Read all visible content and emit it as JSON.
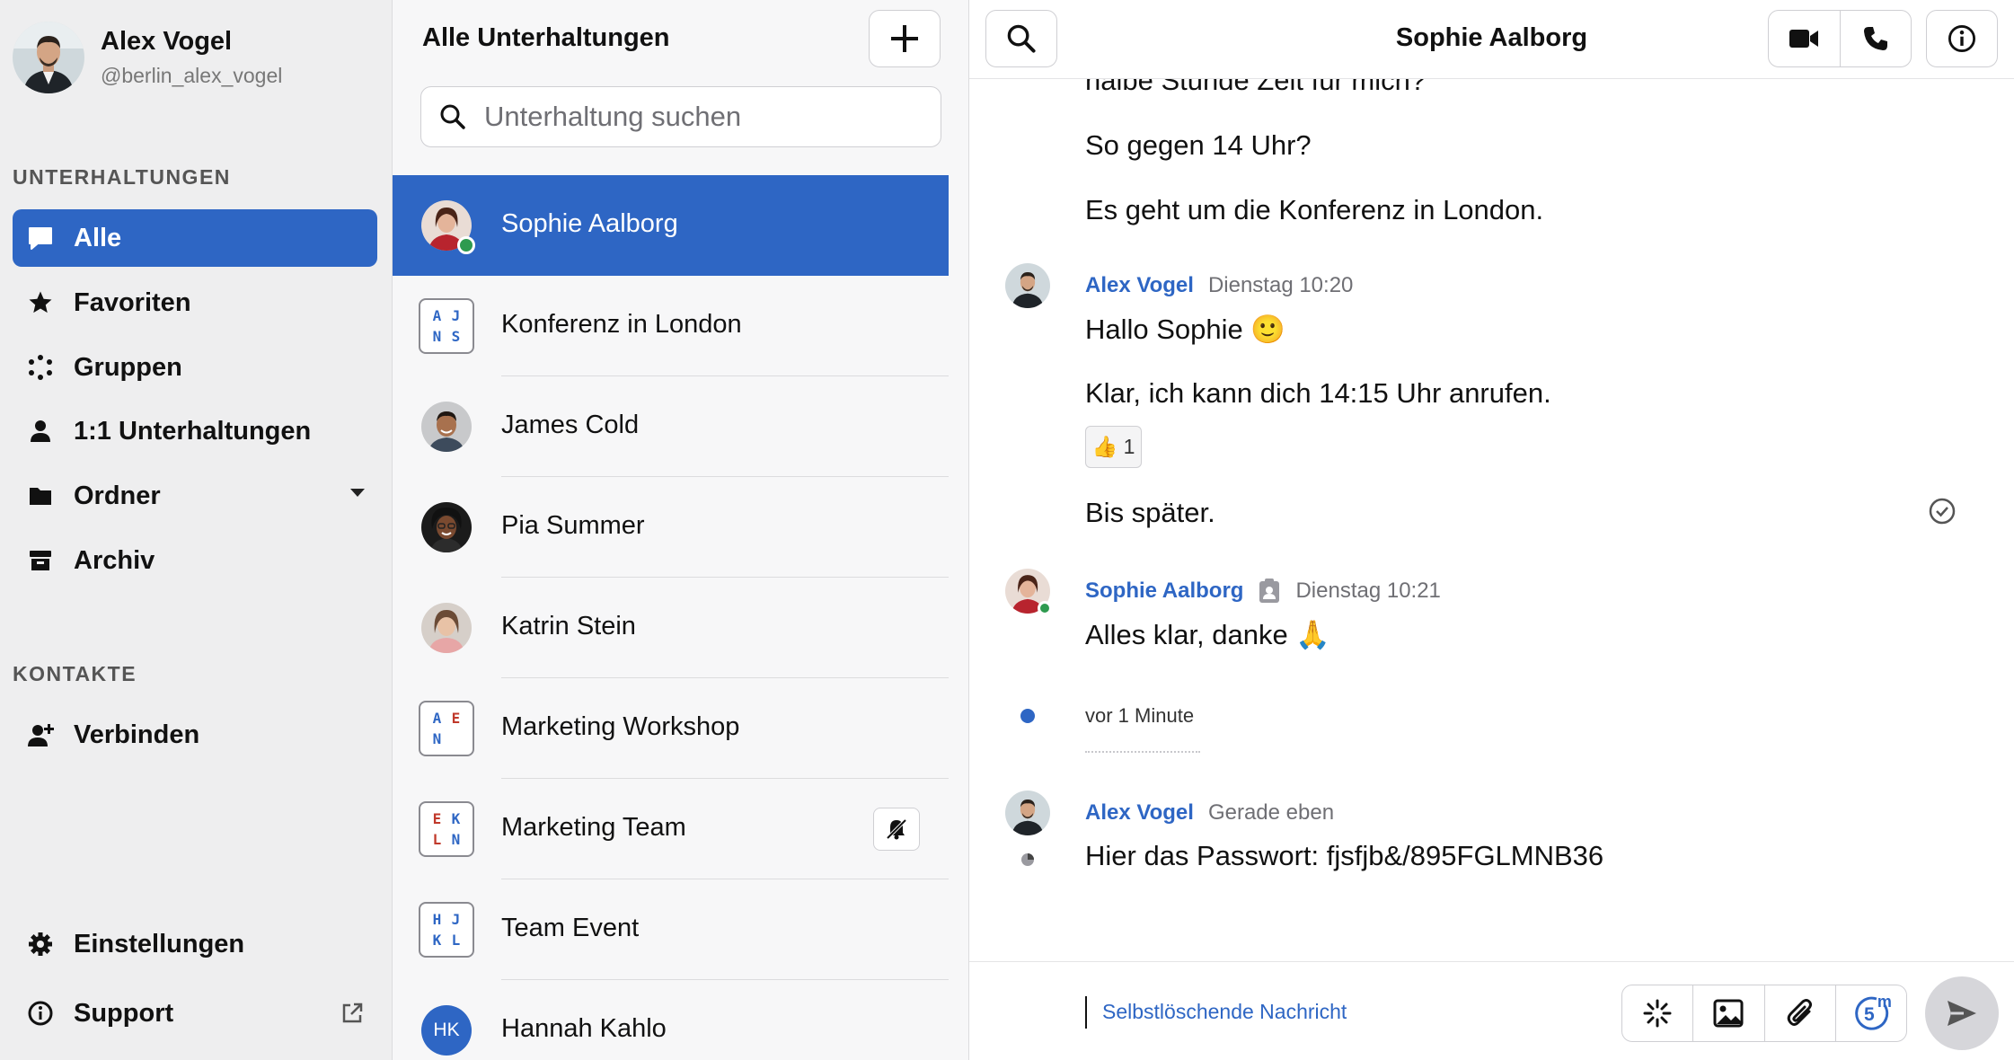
{
  "profile": {
    "name": "Alex Vogel",
    "handle": "@berlin_alex_vogel"
  },
  "sidebar": {
    "section_conversations": "UNTERHALTUNGEN",
    "section_contacts": "KONTAKTE",
    "items": [
      {
        "label": "Alle",
        "icon": "chat-bubble-icon",
        "active": true
      },
      {
        "label": "Favoriten",
        "icon": "star-icon"
      },
      {
        "label": "Gruppen",
        "icon": "groups-icon"
      },
      {
        "label": "1:1 Unterhaltungen",
        "icon": "person-icon"
      },
      {
        "label": "Ordner",
        "icon": "folder-icon"
      },
      {
        "label": "Archiv",
        "icon": "archive-icon"
      }
    ],
    "connect": {
      "label": "Verbinden",
      "icon": "add-person-icon"
    },
    "settings": {
      "label": "Einstellungen",
      "icon": "gear-icon"
    },
    "support": {
      "label": "Support",
      "icon": "info-icon"
    }
  },
  "conversations": {
    "title": "Alle Unterhaltungen",
    "search_placeholder": "Unterhaltung suchen",
    "items": [
      {
        "name": "Sophie Aalborg",
        "type": "person",
        "online": true,
        "active": true
      },
      {
        "name": "Konferenz in London",
        "type": "group",
        "letters": [
          "A",
          "J",
          "N",
          "S"
        ]
      },
      {
        "name": "James Cold",
        "type": "person"
      },
      {
        "name": "Pia Summer",
        "type": "person"
      },
      {
        "name": "Katrin Stein",
        "type": "person"
      },
      {
        "name": "Marketing Workshop",
        "type": "group",
        "letters": [
          "A",
          "E",
          "N",
          ""
        ]
      },
      {
        "name": "Marketing Team",
        "type": "group",
        "letters": [
          "E",
          "K",
          "L",
          "N"
        ],
        "muted": true
      },
      {
        "name": "Team Event",
        "type": "group",
        "letters": [
          "H",
          "J",
          "K",
          "L"
        ]
      },
      {
        "name": "Hannah Kahlo",
        "type": "initials",
        "initials": "HK"
      }
    ]
  },
  "chat": {
    "title": "Sophie Aalborg",
    "messages": {
      "cut_text": "halbe Stunde Zeit für mich?",
      "m1": "So gegen 14 Uhr?",
      "m2": "Es geht um die Konferenz in London.",
      "g1_author": "Alex Vogel",
      "g1_time": "Dienstag 10:20",
      "m3": "Hallo Sophie 🙂",
      "m4": "Klar, ich kann dich 14:15 Uhr anrufen.",
      "reaction": "👍 1",
      "m5": "Bis später.",
      "g2_author": "Sophie Aalborg",
      "g2_time": "Dienstag 10:21",
      "m6": "Alles klar, danke 🙏",
      "timer_label": "vor 1 Minute",
      "g3_author": "Alex Vogel",
      "g3_time": "Gerade eben",
      "m7": "Hier das Passwort: fjsfjb&/895FGLMNB36"
    },
    "composer": {
      "placeholder": "Selbstlöschende Nachricht",
      "timer_badge": "5",
      "timer_unit": "m"
    }
  },
  "colors": {
    "accent": "#2e66c4",
    "online": "#2e9a4f",
    "group_red": "#c0392b"
  }
}
